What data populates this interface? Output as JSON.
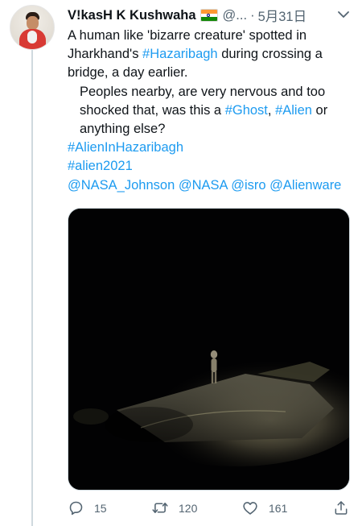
{
  "tweet": {
    "author_name": "V!kasH K Kushwaha",
    "flag_icon": "india-flag-icon",
    "handle": "@...",
    "separator": "·",
    "date": "5月31日",
    "text": {
      "line1": "A human like 'bizarre creature' spotted in Jharkhand's ",
      "hashtag_location": "#Hazaribagh",
      "line1_end": " during crossing a bridge, a day earlier.",
      "line2_start": "Peoples nearby, are very nervous and too shocked  that, was this a ",
      "hashtag_ghost": "#Ghost",
      "comma": ", ",
      "hashtag_alien": "#Alien",
      "line2_end": " or anything else?",
      "hashtag_alien_in_hazaribagh": "#AlienInHazaribagh",
      "hashtag_alien2021": "#alien2021",
      "mention_nasa_johnson": "@NASA_Johnson",
      "mention_nasa": "@NASA",
      "mention_isro": "@isro",
      "mention_alienware": "@Alienware"
    },
    "media_description_icon": "night-road-video-thumbnail",
    "actions": {
      "reply_count": "15",
      "retweet_count": "120",
      "like_count": "161"
    },
    "colors": {
      "link": "#1d9bf0",
      "secondary_text": "#536471",
      "thread_line": "#cfd9de"
    }
  }
}
